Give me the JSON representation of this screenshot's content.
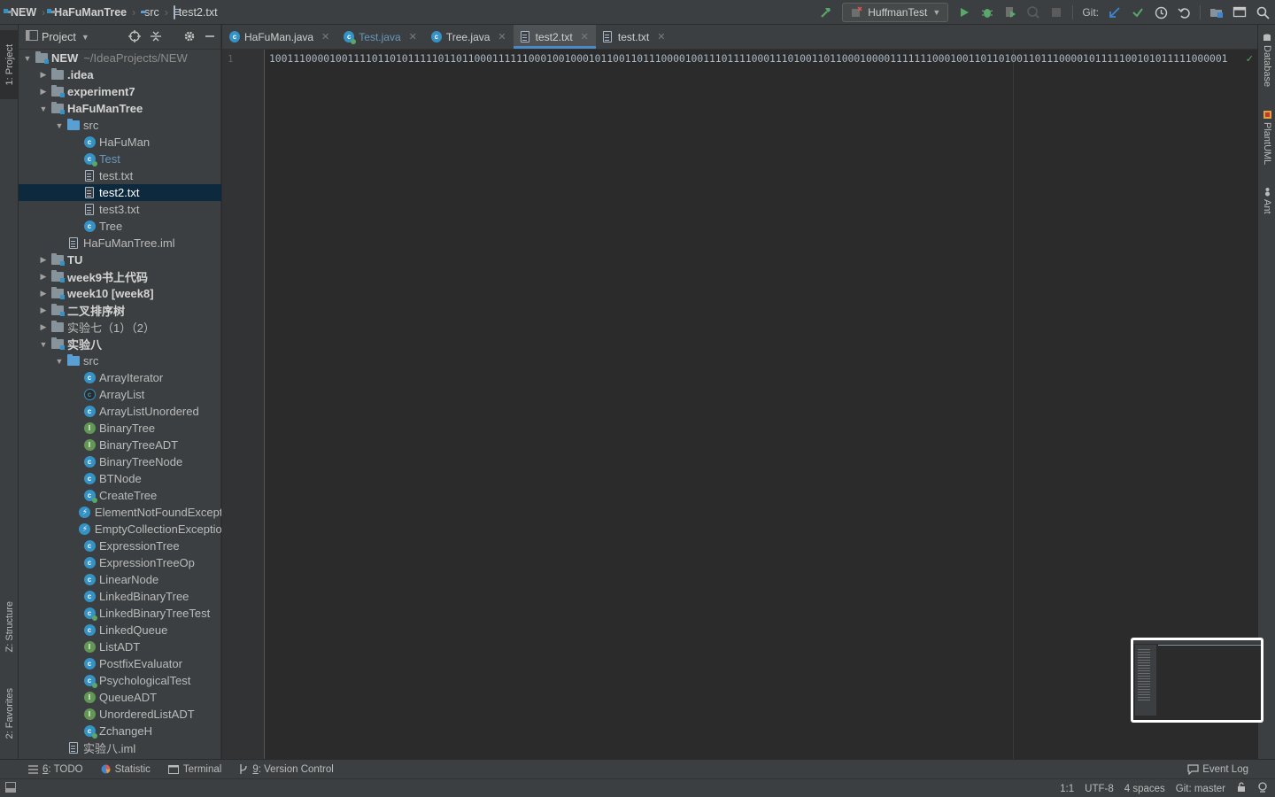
{
  "breadcrumbs": [
    {
      "label": "NEW",
      "icon": "module-folder-icon"
    },
    {
      "label": "HaFuManTree",
      "icon": "module-folder-icon"
    },
    {
      "label": "src",
      "icon": "source-folder-icon"
    },
    {
      "label": "test2.txt",
      "icon": "text-file-icon"
    }
  ],
  "toolbar": {
    "run_config": "HuffmanTest",
    "git_label": "Git:"
  },
  "left_stripe": {
    "project": "1: Project",
    "structure": "Z: Structure",
    "favorites": "2: Favorites"
  },
  "right_stripe": {
    "database": "Database",
    "plantuml": "PlantUML",
    "ant": "Ant"
  },
  "project_panel": {
    "title": "Project",
    "tree": [
      {
        "label": "NEW",
        "sub": "~/IdeaProjects/NEW",
        "depth": 0,
        "arrow": "open",
        "icon": "module",
        "bold": true
      },
      {
        "label": ".idea",
        "depth": 1,
        "arrow": "closed",
        "icon": "folder",
        "bold": true
      },
      {
        "label": "experiment7",
        "depth": 1,
        "arrow": "closed",
        "icon": "module",
        "bold": true
      },
      {
        "label": "HaFuManTree",
        "depth": 1,
        "arrow": "open",
        "icon": "module",
        "bold": true
      },
      {
        "label": "src",
        "depth": 2,
        "arrow": "open",
        "icon": "src"
      },
      {
        "label": "HaFuMan",
        "depth": 3,
        "arrow": "none",
        "icon": "class"
      },
      {
        "label": "Test",
        "depth": 3,
        "arrow": "none",
        "icon": "class-run",
        "mod": true
      },
      {
        "label": "test.txt",
        "depth": 3,
        "arrow": "none",
        "icon": "file"
      },
      {
        "label": "test2.txt",
        "depth": 3,
        "arrow": "none",
        "icon": "file",
        "selected": true
      },
      {
        "label": "test3.txt",
        "depth": 3,
        "arrow": "none",
        "icon": "file"
      },
      {
        "label": "Tree",
        "depth": 3,
        "arrow": "none",
        "icon": "class"
      },
      {
        "label": "HaFuManTree.iml",
        "depth": 2,
        "arrow": "none",
        "icon": "file"
      },
      {
        "label": "TU",
        "depth": 1,
        "arrow": "closed",
        "icon": "module",
        "bold": true
      },
      {
        "label": "week9书上代码",
        "depth": 1,
        "arrow": "closed",
        "icon": "module",
        "bold": true
      },
      {
        "label": "week10 [week8]",
        "depth": 1,
        "arrow": "closed",
        "icon": "module",
        "bold": true
      },
      {
        "label": "二叉排序树",
        "depth": 1,
        "arrow": "closed",
        "icon": "module",
        "bold": true
      },
      {
        "label": "实验七（1）（2）",
        "depth": 1,
        "arrow": "closed",
        "icon": "folder"
      },
      {
        "label": "实验八",
        "depth": 1,
        "arrow": "open",
        "icon": "module",
        "bold": true
      },
      {
        "label": "src",
        "depth": 2,
        "arrow": "open",
        "icon": "src"
      },
      {
        "label": "ArrayIterator",
        "depth": 3,
        "arrow": "none",
        "icon": "class"
      },
      {
        "label": "ArrayList",
        "depth": 3,
        "arrow": "none",
        "icon": "abstract"
      },
      {
        "label": "ArrayListUnordered",
        "depth": 3,
        "arrow": "none",
        "icon": "class"
      },
      {
        "label": "BinaryTree",
        "depth": 3,
        "arrow": "none",
        "icon": "interface"
      },
      {
        "label": "BinaryTreeADT",
        "depth": 3,
        "arrow": "none",
        "icon": "interface"
      },
      {
        "label": "BinaryTreeNode",
        "depth": 3,
        "arrow": "none",
        "icon": "class"
      },
      {
        "label": "BTNode",
        "depth": 3,
        "arrow": "none",
        "icon": "class"
      },
      {
        "label": "CreateTree",
        "depth": 3,
        "arrow": "none",
        "icon": "class-run"
      },
      {
        "label": "ElementNotFoundException",
        "depth": 3,
        "arrow": "none",
        "icon": "exception"
      },
      {
        "label": "EmptyCollectionException",
        "depth": 3,
        "arrow": "none",
        "icon": "exception"
      },
      {
        "label": "ExpressionTree",
        "depth": 3,
        "arrow": "none",
        "icon": "class"
      },
      {
        "label": "ExpressionTreeOp",
        "depth": 3,
        "arrow": "none",
        "icon": "class"
      },
      {
        "label": "LinearNode",
        "depth": 3,
        "arrow": "none",
        "icon": "class"
      },
      {
        "label": "LinkedBinaryTree",
        "depth": 3,
        "arrow": "none",
        "icon": "class"
      },
      {
        "label": "LinkedBinaryTreeTest",
        "depth": 3,
        "arrow": "none",
        "icon": "class-run"
      },
      {
        "label": "LinkedQueue",
        "depth": 3,
        "arrow": "none",
        "icon": "class"
      },
      {
        "label": "ListADT",
        "depth": 3,
        "arrow": "none",
        "icon": "interface"
      },
      {
        "label": "PostfixEvaluator",
        "depth": 3,
        "arrow": "none",
        "icon": "class"
      },
      {
        "label": "PsychologicalTest",
        "depth": 3,
        "arrow": "none",
        "icon": "class-run"
      },
      {
        "label": "QueueADT",
        "depth": 3,
        "arrow": "none",
        "icon": "interface"
      },
      {
        "label": "UnorderedListADT",
        "depth": 3,
        "arrow": "none",
        "icon": "interface"
      },
      {
        "label": "ZchangeH",
        "depth": 3,
        "arrow": "none",
        "icon": "class-run"
      },
      {
        "label": "实验八.iml",
        "depth": 2,
        "arrow": "none",
        "icon": "file"
      }
    ]
  },
  "editor_tabs": [
    {
      "label": "HaFuMan.java",
      "icon": "class",
      "active": false,
      "mod": false
    },
    {
      "label": "Test.java",
      "icon": "class-run",
      "active": false,
      "mod": true
    },
    {
      "label": "Tree.java",
      "icon": "class",
      "active": false,
      "mod": false
    },
    {
      "label": "test2.txt",
      "icon": "file",
      "active": true,
      "mod": false
    },
    {
      "label": "test.txt",
      "icon": "file",
      "active": false,
      "mod": false
    }
  ],
  "editor": {
    "line_number": "1",
    "content": "100111000010011110110101111101101100011111100010010001011001101110000100111011110001110100110110001000011111110001001101101001101110000101111100101011111000001"
  },
  "bottom_tools": {
    "todo_num": "6",
    "todo_label": ": TODO",
    "statistic": "Statistic",
    "terminal": "Terminal",
    "vcs_num": "9",
    "vcs_label": ": Version Control",
    "event_log": "Event Log"
  },
  "status": {
    "position": "1:1",
    "encoding": "UTF-8",
    "indent": "4 spaces",
    "git_branch": "Git: master"
  }
}
